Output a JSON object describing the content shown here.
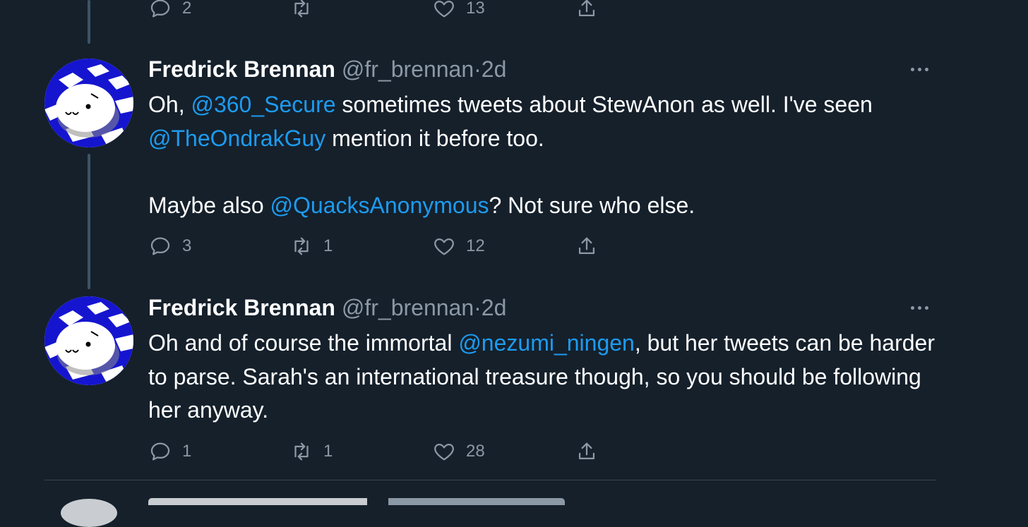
{
  "top_actions": {
    "reply": "2",
    "retweet": "",
    "like": "13"
  },
  "tweets": [
    {
      "name": "Fredrick Brennan",
      "handle": "@fr_brennan",
      "dot": "·",
      "time": "2d",
      "text": {
        "p1a": "Oh, ",
        "m1": "@360_Secure",
        "p1b": " sometimes tweets about StewAnon as well. I've seen ",
        "m2": "@TheOndrakGuy",
        "p1c": " mention it before too.",
        "p2a": "Maybe also ",
        "m3": "@QuacksAnonymous",
        "p2b": "? Not sure who else."
      },
      "actions": {
        "reply": "3",
        "retweet": "1",
        "like": "12"
      }
    },
    {
      "name": "Fredrick Brennan",
      "handle": "@fr_brennan",
      "dot": "·",
      "time": "2d",
      "text": {
        "p1a": "Oh and of course the immortal ",
        "m1": "@nezumi_ningen",
        "p1b": ", but her tweets can be harder to parse. Sarah's an international treasure though, so you should be following her anyway."
      },
      "actions": {
        "reply": "1",
        "retweet": "1",
        "like": "28"
      }
    }
  ],
  "colors": {
    "background": "#15202b",
    "mention": "#1d9bf0",
    "secondary": "#8b98a5",
    "thread_line": "#3d5466"
  }
}
